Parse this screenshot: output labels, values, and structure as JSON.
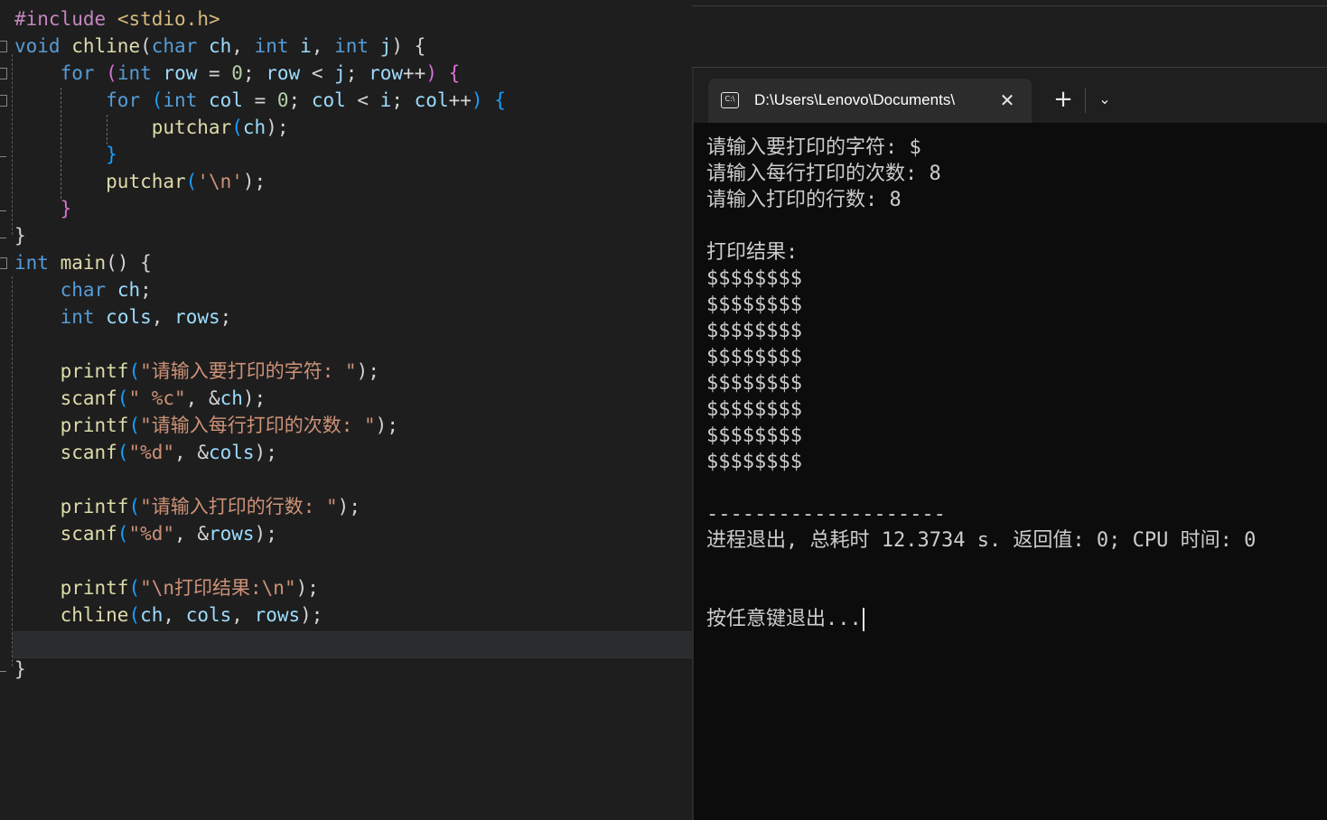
{
  "editor": {
    "lines": [
      [
        "#include",
        " ",
        "<stdio.h>"
      ],
      [
        "void",
        " ",
        "chline",
        "(",
        "char",
        " ",
        "ch",
        ", ",
        "int",
        " ",
        "i",
        ", ",
        "int",
        " ",
        "j",
        ") {"
      ],
      [
        "    ",
        "for",
        " ",
        "(",
        "int",
        " ",
        "row",
        " = ",
        "0",
        "; ",
        "row",
        " < ",
        "j",
        "; ",
        "row",
        "++",
        ")",
        " {"
      ],
      [
        "        ",
        "for",
        " ",
        "(",
        "int",
        " ",
        "col",
        " = ",
        "0",
        "; ",
        "col",
        " < ",
        "i",
        "; ",
        "col",
        "++",
        ")",
        " {"
      ],
      [
        "            ",
        "putchar",
        "(",
        "ch",
        ");"
      ],
      [
        "        ",
        "}"
      ],
      [
        "        ",
        "putchar",
        "(",
        "'\\n'",
        ");"
      ],
      [
        "    ",
        "}"
      ],
      [
        "}"
      ],
      [
        "int",
        " ",
        "main",
        "() {"
      ],
      [
        "    ",
        "char",
        " ",
        "ch",
        ";"
      ],
      [
        "    ",
        "int",
        " ",
        "cols",
        ", ",
        "rows",
        ";"
      ],
      [
        ""
      ],
      [
        "    ",
        "printf",
        "(",
        "\"请输入要打印的字符: \"",
        ");"
      ],
      [
        "    ",
        "scanf",
        "(",
        "\" %c\"",
        ", &",
        "ch",
        ");"
      ],
      [
        "    ",
        "printf",
        "(",
        "\"请输入每行打印的次数: \"",
        ");"
      ],
      [
        "    ",
        "scanf",
        "(",
        "\"%d\"",
        ", &",
        "cols",
        ");"
      ],
      [
        ""
      ],
      [
        "    ",
        "printf",
        "(",
        "\"请输入打印的行数: \"",
        ");"
      ],
      [
        "    ",
        "scanf",
        "(",
        "\"%d\"",
        ", &",
        "rows",
        ");"
      ],
      [
        ""
      ],
      [
        "    ",
        "printf",
        "(",
        "\"\\n打印结果:\\n\"",
        ");"
      ],
      [
        "    ",
        "chline",
        "(",
        "ch",
        ", ",
        "cols",
        ", ",
        "rows",
        ");"
      ],
      [
        ""
      ],
      [
        "}"
      ]
    ]
  },
  "terminal": {
    "tab_title": "D:\\Users\\Lenovo\\Documents\\",
    "tab_icon": "terminal-icon",
    "close_glyph": "✕",
    "new_tab_glyph": "+",
    "dropdown_glyph": "⌄",
    "output": [
      "请输入要打印的字符: $",
      "请输入每行打印的次数: 8",
      "请输入打印的行数: 8",
      "",
      "打印结果:",
      "$$$$$$$$",
      "$$$$$$$$",
      "$$$$$$$$",
      "$$$$$$$$",
      "$$$$$$$$",
      "$$$$$$$$",
      "$$$$$$$$",
      "$$$$$$$$",
      "",
      "--------------------",
      "进程退出, 总耗时 12.3734 s. 返回值: 0; CPU 时间: 0",
      "",
      "",
      "按任意键退出..."
    ]
  },
  "colors": {
    "editor_bg": "#1e1e1e",
    "terminal_bg": "#0c0c0c",
    "keyword": "#569cd6",
    "function": "#dcdcaa",
    "string": "#ce9178",
    "number": "#b5cea8",
    "variable": "#9cdcfe"
  }
}
